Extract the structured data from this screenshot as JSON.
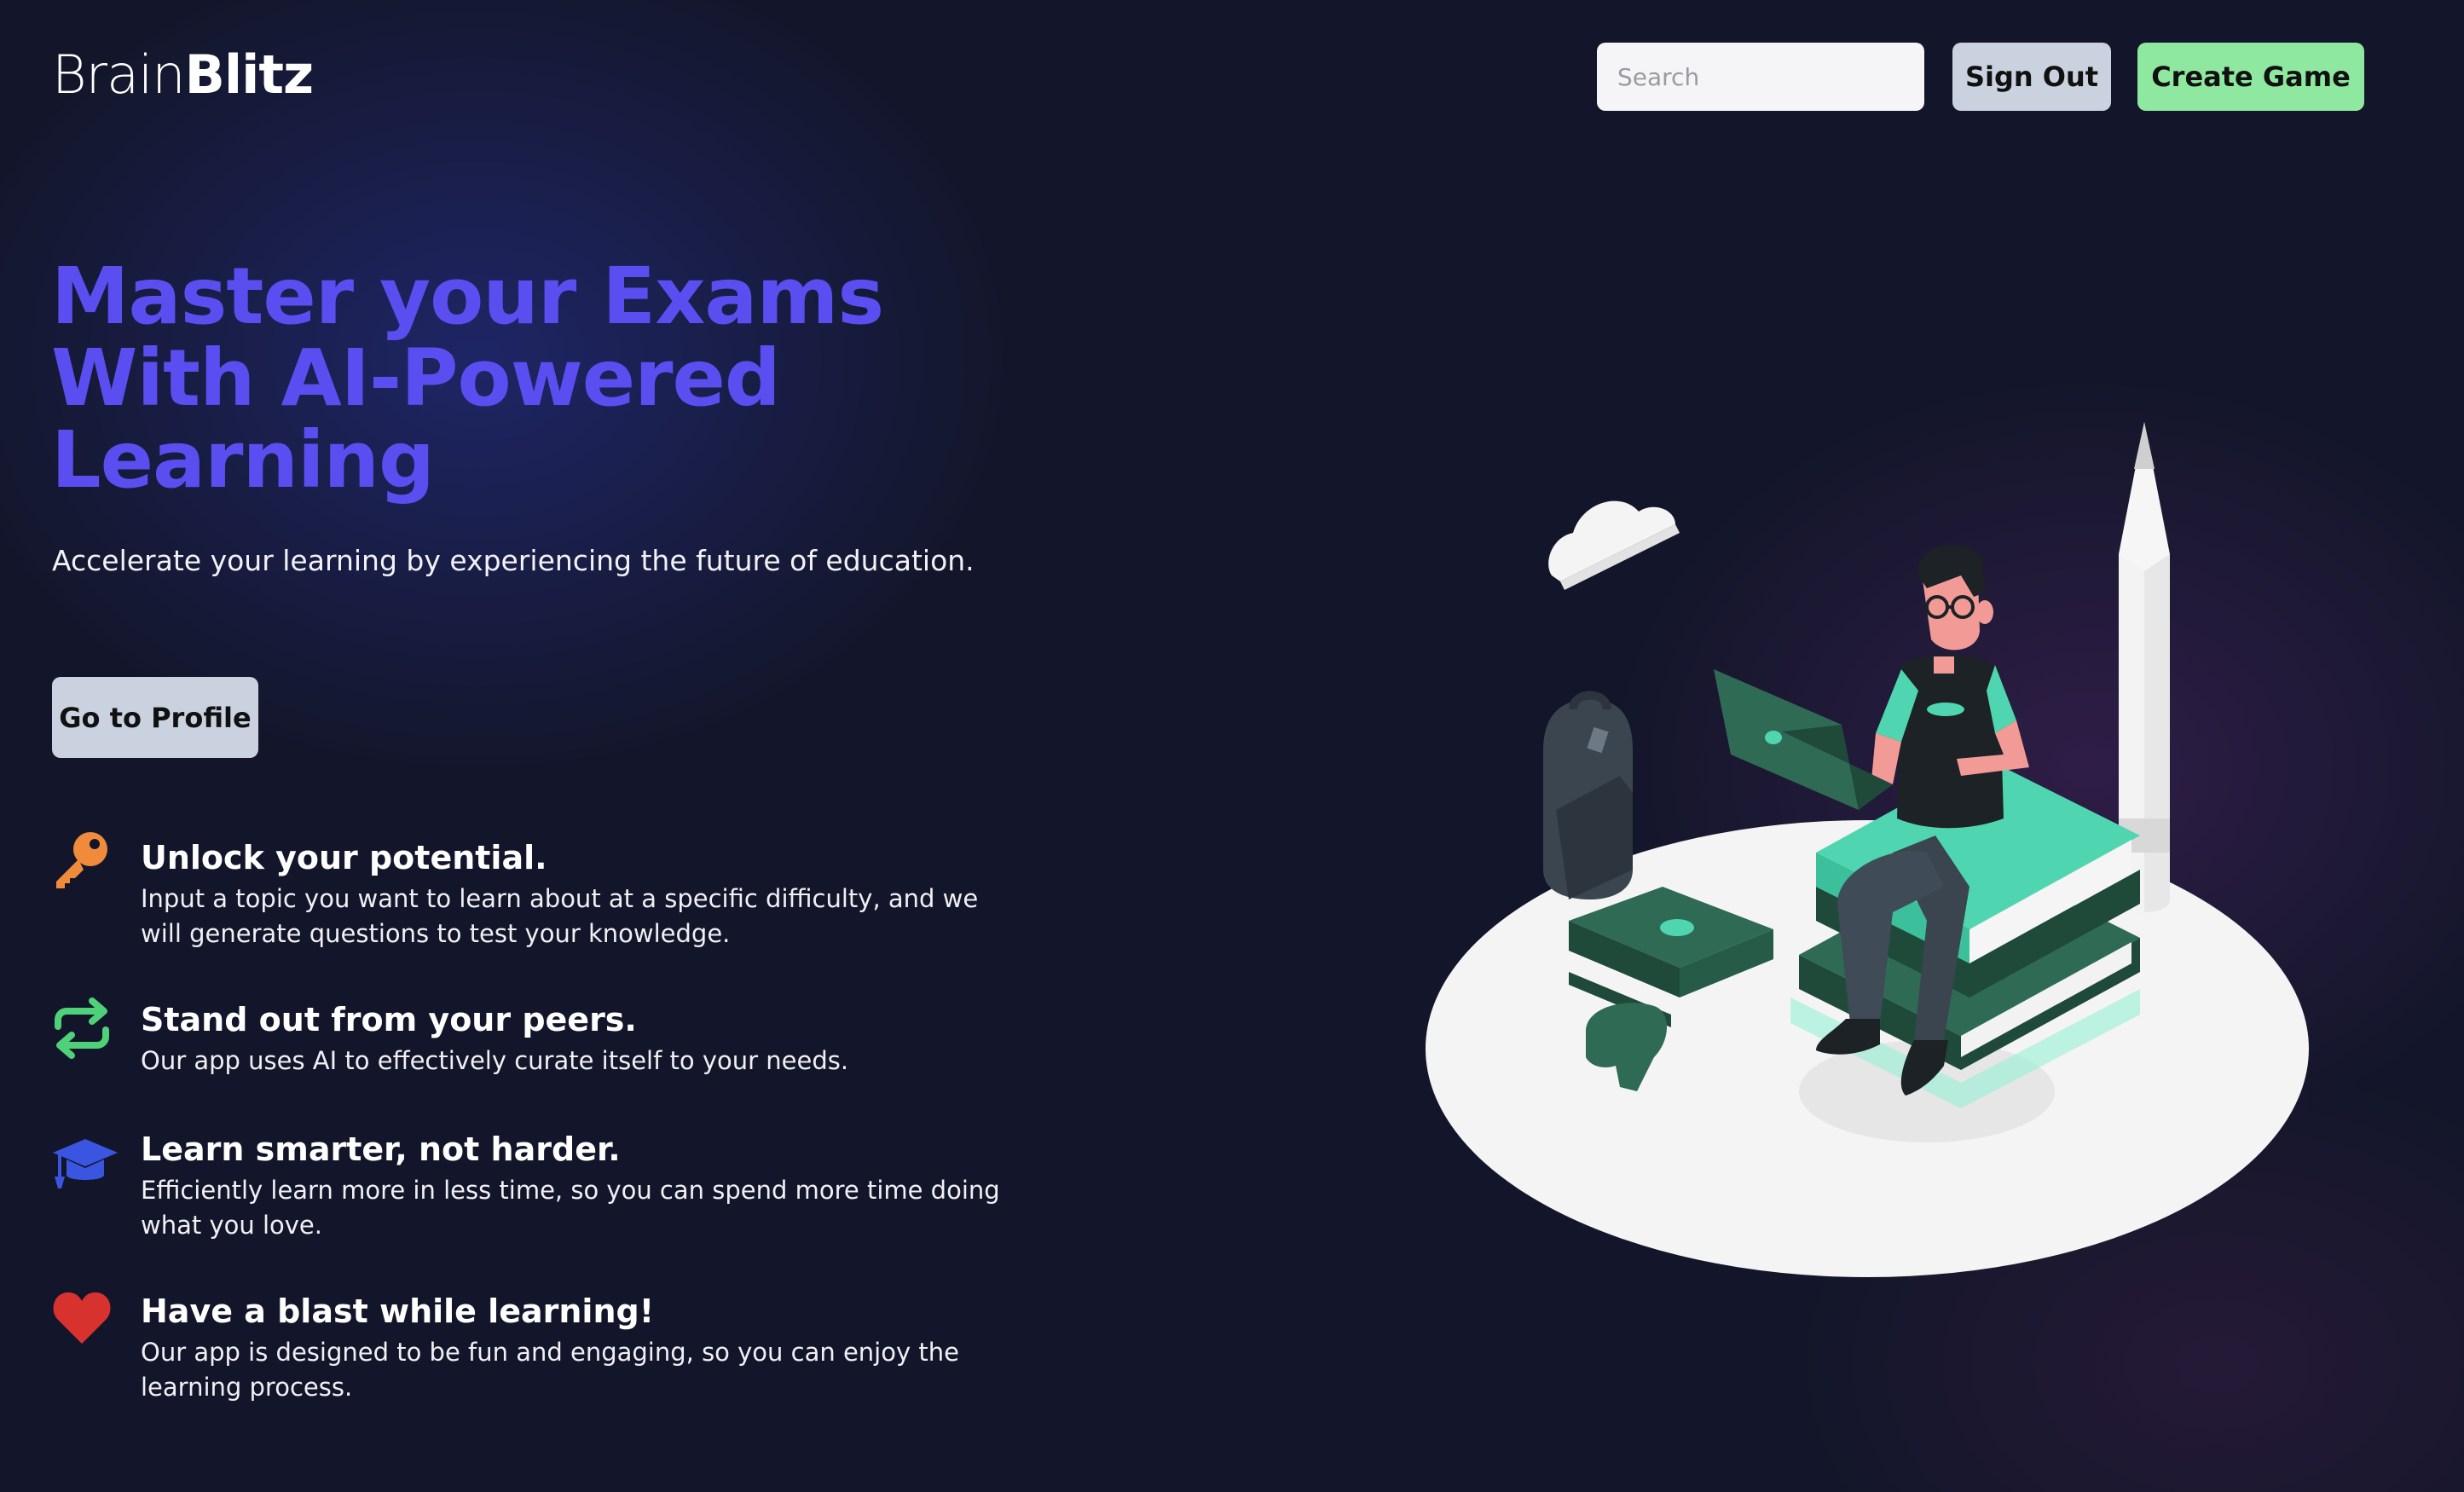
{
  "header": {
    "logo_part1": "Brain",
    "logo_part2": "Blitz",
    "search_placeholder": "Search",
    "signout_label": "Sign Out",
    "create_label": "Create Game"
  },
  "hero": {
    "headline_line1": "Master your Exams",
    "headline_line2": "With AI-Powered",
    "headline_line3": "Learning",
    "subtitle": "Accelerate your learning by experiencing the future of education.",
    "profile_button": "Go to Profile"
  },
  "features": [
    {
      "icon": "key-icon",
      "title": "Unlock your potential.",
      "description": "Input a topic you want to learn about at a specific difficulty, and we will generate questions to test your knowledge."
    },
    {
      "icon": "repeat-arrows-icon",
      "title": "Stand out from your peers.",
      "description": "Our app uses AI to effectively curate itself to your needs."
    },
    {
      "icon": "graduation-cap-icon",
      "title": "Learn smarter, not harder.",
      "description": "Efficiently learn more in less time, so you can spend more time doing what you love."
    },
    {
      "icon": "heart-icon",
      "title": "Have a blast while learning!",
      "description": "Our app is designed to be fun and engaging, so you can enjoy the learning process."
    }
  ],
  "colors": {
    "background": "#13162a",
    "headline": "#5b4ef0",
    "create_button": "#8fe8a0",
    "secondary_button": "#c9d2de",
    "key_icon": "#ef8b3b",
    "repeat_icon": "#4fd17a",
    "cap_icon": "#3a55e0",
    "heart_icon": "#d8322e",
    "illustration_accent": "#4fd6b0"
  }
}
